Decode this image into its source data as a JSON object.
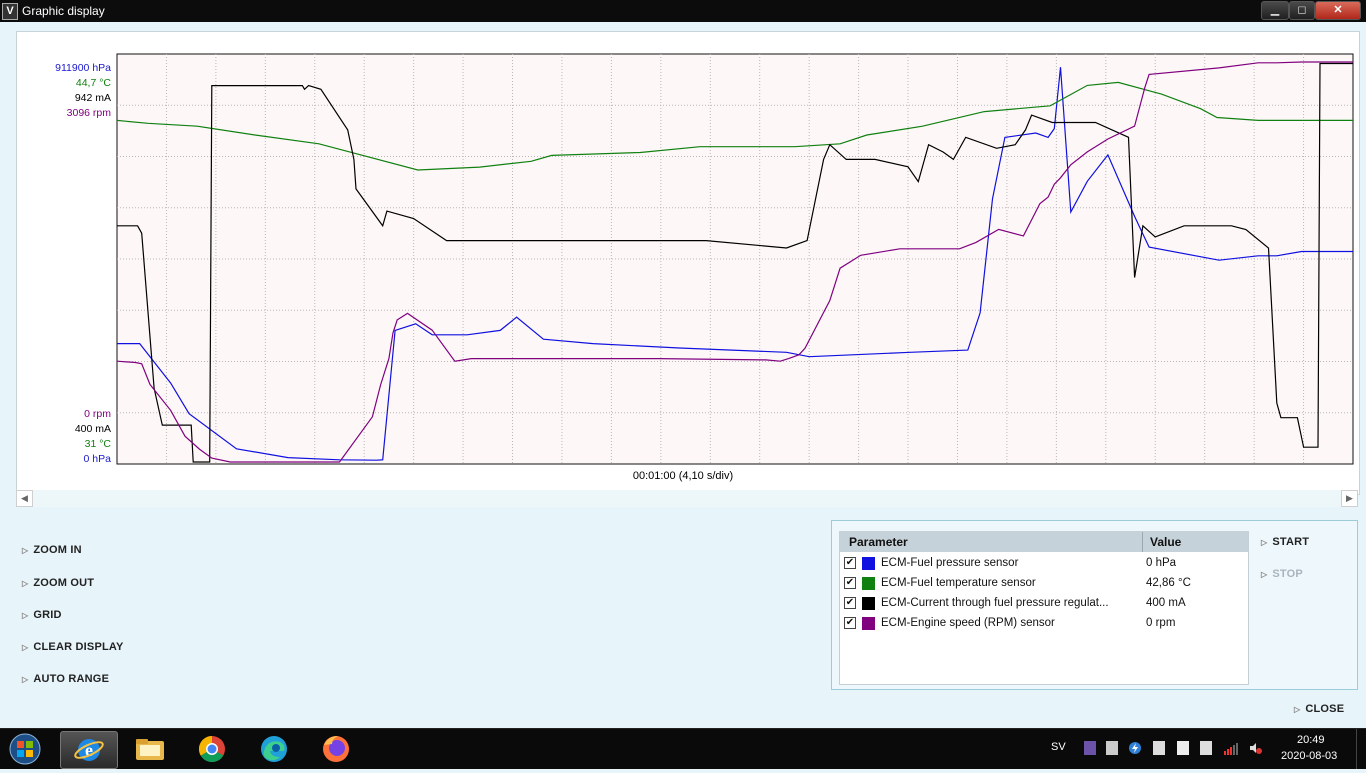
{
  "window": {
    "app_icon": "V",
    "title": "Graphic display",
    "min_label": "▁",
    "max_label": "◻",
    "close_label": "✕"
  },
  "chart_data": {
    "type": "line",
    "xlabel": "00:01:00 (4,10 s/div)",
    "x_range": [
      0,
      60
    ],
    "grid": true,
    "scale_labels": {
      "top": [
        {
          "text": "911900 hPa",
          "color": "#1a1ad0"
        },
        {
          "text": "44,7 °C",
          "color": "#108010"
        },
        {
          "text": "942 mA",
          "color": "#000000"
        },
        {
          "text": "3096 rpm",
          "color": "#800080"
        }
      ],
      "bottom": [
        {
          "text": "0 rpm",
          "color": "#800080"
        },
        {
          "text": "400 mA",
          "color": "#000000"
        },
        {
          "text": "31 °C",
          "color": "#108010"
        },
        {
          "text": "0 hPa",
          "color": "#1a1ad0"
        }
      ]
    },
    "series": [
      {
        "name": "ECM-Fuel pressure sensor",
        "color": "#1010e0",
        "unit": "hPa",
        "ylim": [
          0,
          911900
        ],
        "x": [
          0,
          1.1,
          1.6,
          2.6,
          3.5,
          5.8,
          8.3,
          10.8,
          12.6,
          12.9,
          13.5,
          14.5,
          15.3,
          17,
          18.6,
          19.4,
          20.7,
          23.1,
          27.3,
          32.5,
          33.6,
          38.5,
          41.3,
          41.9,
          42.5,
          43.1,
          44.6,
          45.2,
          45.5,
          45.8,
          46.3,
          47.1,
          48.1,
          49.4,
          49.9,
          50.1,
          53.5,
          55.4,
          56.3,
          57.5,
          60
        ],
        "y": [
          270000,
          270000,
          240000,
          180000,
          110000,
          30000,
          10000,
          5000,
          4000,
          5000,
          300000,
          315000,
          290000,
          290000,
          300000,
          330000,
          280000,
          270000,
          260000,
          250000,
          240000,
          250000,
          255000,
          340000,
          600000,
          740000,
          750000,
          740000,
          760000,
          900000,
          570000,
          640000,
          700000,
          560000,
          510000,
          490000,
          460000,
          470000,
          470000,
          480000,
          480000
        ]
      },
      {
        "name": "ECM-Fuel temperature sensor",
        "color": "#108010",
        "unit": "°C",
        "ylim": [
          31,
          44.7
        ],
        "x": [
          0,
          1.5,
          3.9,
          6.7,
          9.8,
          14.6,
          17.6,
          20.1,
          21.1,
          25.4,
          28.3,
          30.3,
          32.9,
          35.1,
          36.4,
          39.1,
          42.1,
          45.3,
          47.1,
          48.6,
          50.7,
          52.6,
          53.4,
          55.4,
          58.8,
          60
        ],
        "y": [
          42.7,
          42.6,
          42.5,
          42.2,
          41.9,
          41.0,
          41.1,
          41.3,
          41.5,
          41.6,
          41.8,
          41.8,
          41.8,
          41.9,
          42.2,
          42.5,
          43.0,
          43.2,
          43.9,
          44.0,
          43.6,
          43.1,
          42.8,
          42.7,
          42.7,
          42.7
        ]
      },
      {
        "name": "ECM-Current through fuel pressure regulat...",
        "color": "#000000",
        "unit": "mA",
        "ylim": [
          400,
          942
        ],
        "x": [
          0,
          0.5,
          1,
          1.2,
          1.8,
          2.2,
          3.6,
          3.7,
          4.5,
          4.6,
          9,
          9.1,
          9.3,
          9.9,
          11.2,
          11.5,
          11.6,
          12.9,
          13.1,
          14.4,
          16,
          21.6,
          28.6,
          32.5,
          33.5,
          34.3,
          34.6,
          35.4,
          36.8,
          38.4,
          38.9,
          39.4,
          40.1,
          40.6,
          41.2,
          42.7,
          43.6,
          44.1,
          44.4,
          45.4,
          47.5,
          49.1,
          49.4,
          49.8,
          50.4,
          51.8,
          52.2,
          53.5,
          54.1,
          54.8,
          55.9,
          56.3,
          56.5,
          57.3,
          57.6,
          58.3,
          58.4,
          60
        ],
        "y": [
          720,
          720,
          720,
          710,
          500,
          450,
          450,
          400,
          400,
          910,
          910,
          905,
          910,
          905,
          850,
          810,
          770,
          720,
          740,
          730,
          700,
          700,
          700,
          690,
          700,
          810,
          830,
          810,
          810,
          800,
          780,
          830,
          820,
          810,
          840,
          825,
          830,
          850,
          870,
          860,
          860,
          840,
          650,
          720,
          705,
          720,
          720,
          720,
          720,
          715,
          690,
          480,
          460,
          460,
          420,
          420,
          940,
          940
        ]
      },
      {
        "name": "ECM-Engine speed (RPM) sensor",
        "color": "#800080",
        "unit": "rpm",
        "ylim": [
          0,
          3096
        ],
        "x": [
          0,
          0.9,
          1.2,
          1.6,
          2.6,
          3.3,
          4,
          4.6,
          5.5,
          6.5,
          7.2,
          8.3,
          10.8,
          12.4,
          12.8,
          13.2,
          13.4,
          13.6,
          14.1,
          15.3,
          16.4,
          17.2,
          17.7,
          26.3,
          31.5,
          32.2,
          32.6,
          33.1,
          33.4,
          34.6,
          35.1,
          36.1,
          38,
          40.9,
          41.7,
          42.8,
          44,
          44.8,
          45.2,
          45.5,
          45.8,
          46.3,
          47.1,
          48.1,
          49.4,
          49.9,
          50.1,
          53.5,
          55.4,
          56.3,
          57.5,
          60
        ],
        "y": [
          780,
          770,
          760,
          600,
          400,
          200,
          100,
          30,
          0,
          0,
          0,
          0,
          0,
          350,
          600,
          800,
          1000,
          1100,
          1150,
          1020,
          780,
          800,
          800,
          800,
          790,
          780,
          800,
          830,
          880,
          1250,
          1500,
          1600,
          1650,
          1650,
          1700,
          1800,
          1750,
          2000,
          2050,
          2150,
          2200,
          2300,
          2400,
          2500,
          2600,
          2900,
          3000,
          3050,
          3090,
          3090,
          3096,
          3096
        ]
      }
    ]
  },
  "scroll": {
    "left_arrow": "◀",
    "right_arrow": "▶"
  },
  "actions": {
    "zoom_in": "ZOOM IN",
    "zoom_out": "ZOOM OUT",
    "grid": "GRID",
    "clear_display": "CLEAR DISPLAY",
    "auto_range": "AUTO RANGE",
    "start": "START",
    "stop": "STOP",
    "close": "CLOSE"
  },
  "parameters": {
    "header_param": "Parameter",
    "header_value": "Value",
    "rows": [
      {
        "checked": "✔",
        "color": "#1010e0",
        "name": "ECM-Fuel pressure sensor",
        "value": "0 hPa"
      },
      {
        "checked": "✔",
        "color": "#108010",
        "name": "ECM-Fuel temperature sensor",
        "value": "42,86 °C"
      },
      {
        "checked": "✔",
        "color": "#000000",
        "name": "ECM-Current through fuel pressure regulat...",
        "value": "400 mA"
      },
      {
        "checked": "✔",
        "color": "#800080",
        "name": "ECM-Engine speed (RPM) sensor",
        "value": "0 rpm"
      }
    ]
  },
  "taskbar": {
    "icons": [
      "windows-start-icon",
      "internet-explorer-icon",
      "file-explorer-icon",
      "chrome-icon",
      "edge-icon",
      "firefox-icon"
    ],
    "language": "SV",
    "time": "20:49",
    "date": "2020-08-03"
  }
}
